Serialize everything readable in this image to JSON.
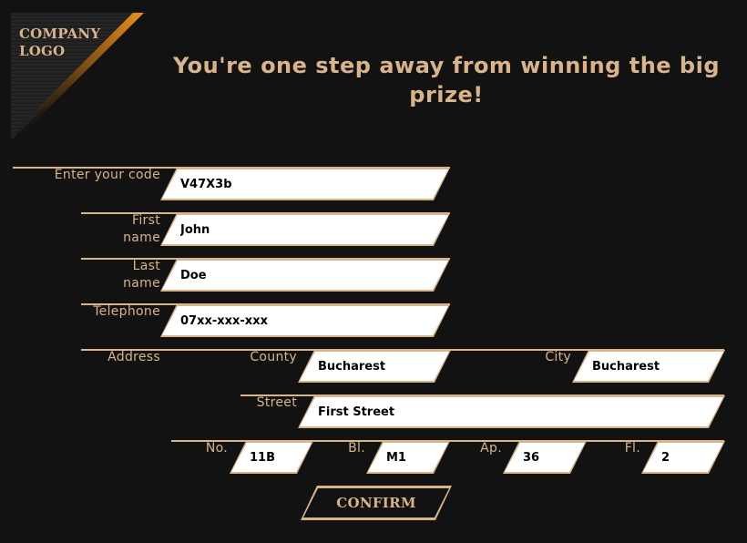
{
  "logo": {
    "line1": "COMPANY",
    "line2": "LOGO"
  },
  "headline": "You're one step away from winning the big prize!",
  "form": {
    "code": {
      "label": "Enter your code",
      "value": "V47X3b"
    },
    "first_name": {
      "label_line1": "First",
      "label_line2": "name",
      "value": "John"
    },
    "last_name": {
      "label_line1": "Last",
      "label_line2": "name",
      "value": "Doe"
    },
    "telephone": {
      "label": "Telephone",
      "value": "07xx-xxx-xxx"
    },
    "address": {
      "label": "Address",
      "county": {
        "label": "County",
        "value": "Bucharest"
      },
      "city": {
        "label": "City",
        "value": "Bucharest"
      },
      "street": {
        "label": "Street",
        "value": "First Street"
      },
      "number": {
        "label": "No.",
        "value": "11B"
      },
      "block": {
        "label": "Bl.",
        "value": "M1"
      },
      "apartment": {
        "label": "Ap.",
        "value": "36"
      },
      "floor": {
        "label": "Fl.",
        "value": "2"
      }
    },
    "confirm_label": "CONFIRM"
  },
  "colors": {
    "accent": "#d9b48a",
    "background": "#121212",
    "logo_gradient": "#e08a1a",
    "field_bg": "#ffffff"
  }
}
